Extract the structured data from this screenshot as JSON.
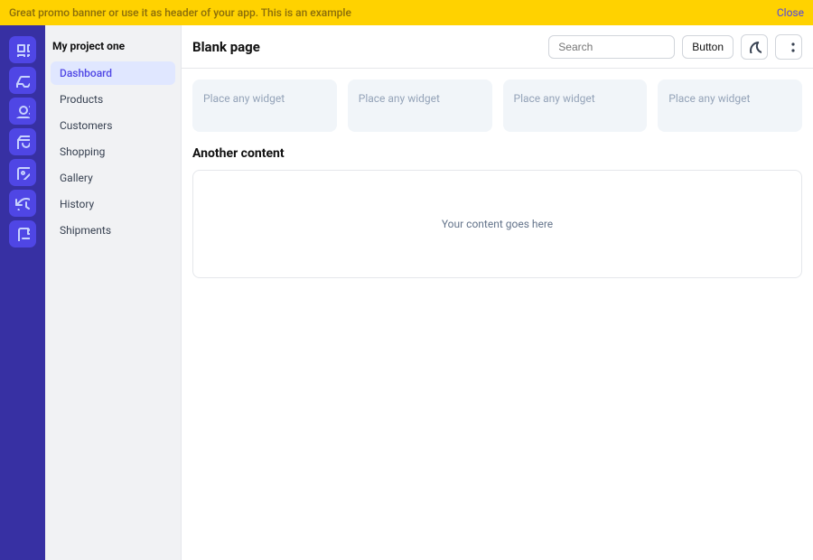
{
  "promo": {
    "text": "Great promo banner or use it as header of your app. This is an example",
    "close_label": "Close"
  },
  "rail": {
    "items": [
      {
        "name": "dashboard-icon"
      },
      {
        "name": "inbox-icon"
      },
      {
        "name": "users-icon"
      },
      {
        "name": "shopping-icon"
      },
      {
        "name": "image-icon"
      },
      {
        "name": "history-icon"
      },
      {
        "name": "document-icon"
      }
    ]
  },
  "sidebar": {
    "title": "My project one",
    "items": [
      {
        "label": "Dashboard",
        "active": true
      },
      {
        "label": "Products"
      },
      {
        "label": "Customers"
      },
      {
        "label": "Shopping"
      },
      {
        "label": "Gallery"
      },
      {
        "label": "History"
      },
      {
        "label": "Shipments"
      }
    ]
  },
  "header": {
    "title": "Blank page",
    "search_placeholder": "Search",
    "button_label": "Button"
  },
  "widgets": [
    {
      "placeholder": "Place any widget"
    },
    {
      "placeholder": "Place any widget"
    },
    {
      "placeholder": "Place any widget"
    },
    {
      "placeholder": "Place any widget"
    }
  ],
  "section": {
    "title": "Another content",
    "body_placeholder": "Your content goes here"
  }
}
